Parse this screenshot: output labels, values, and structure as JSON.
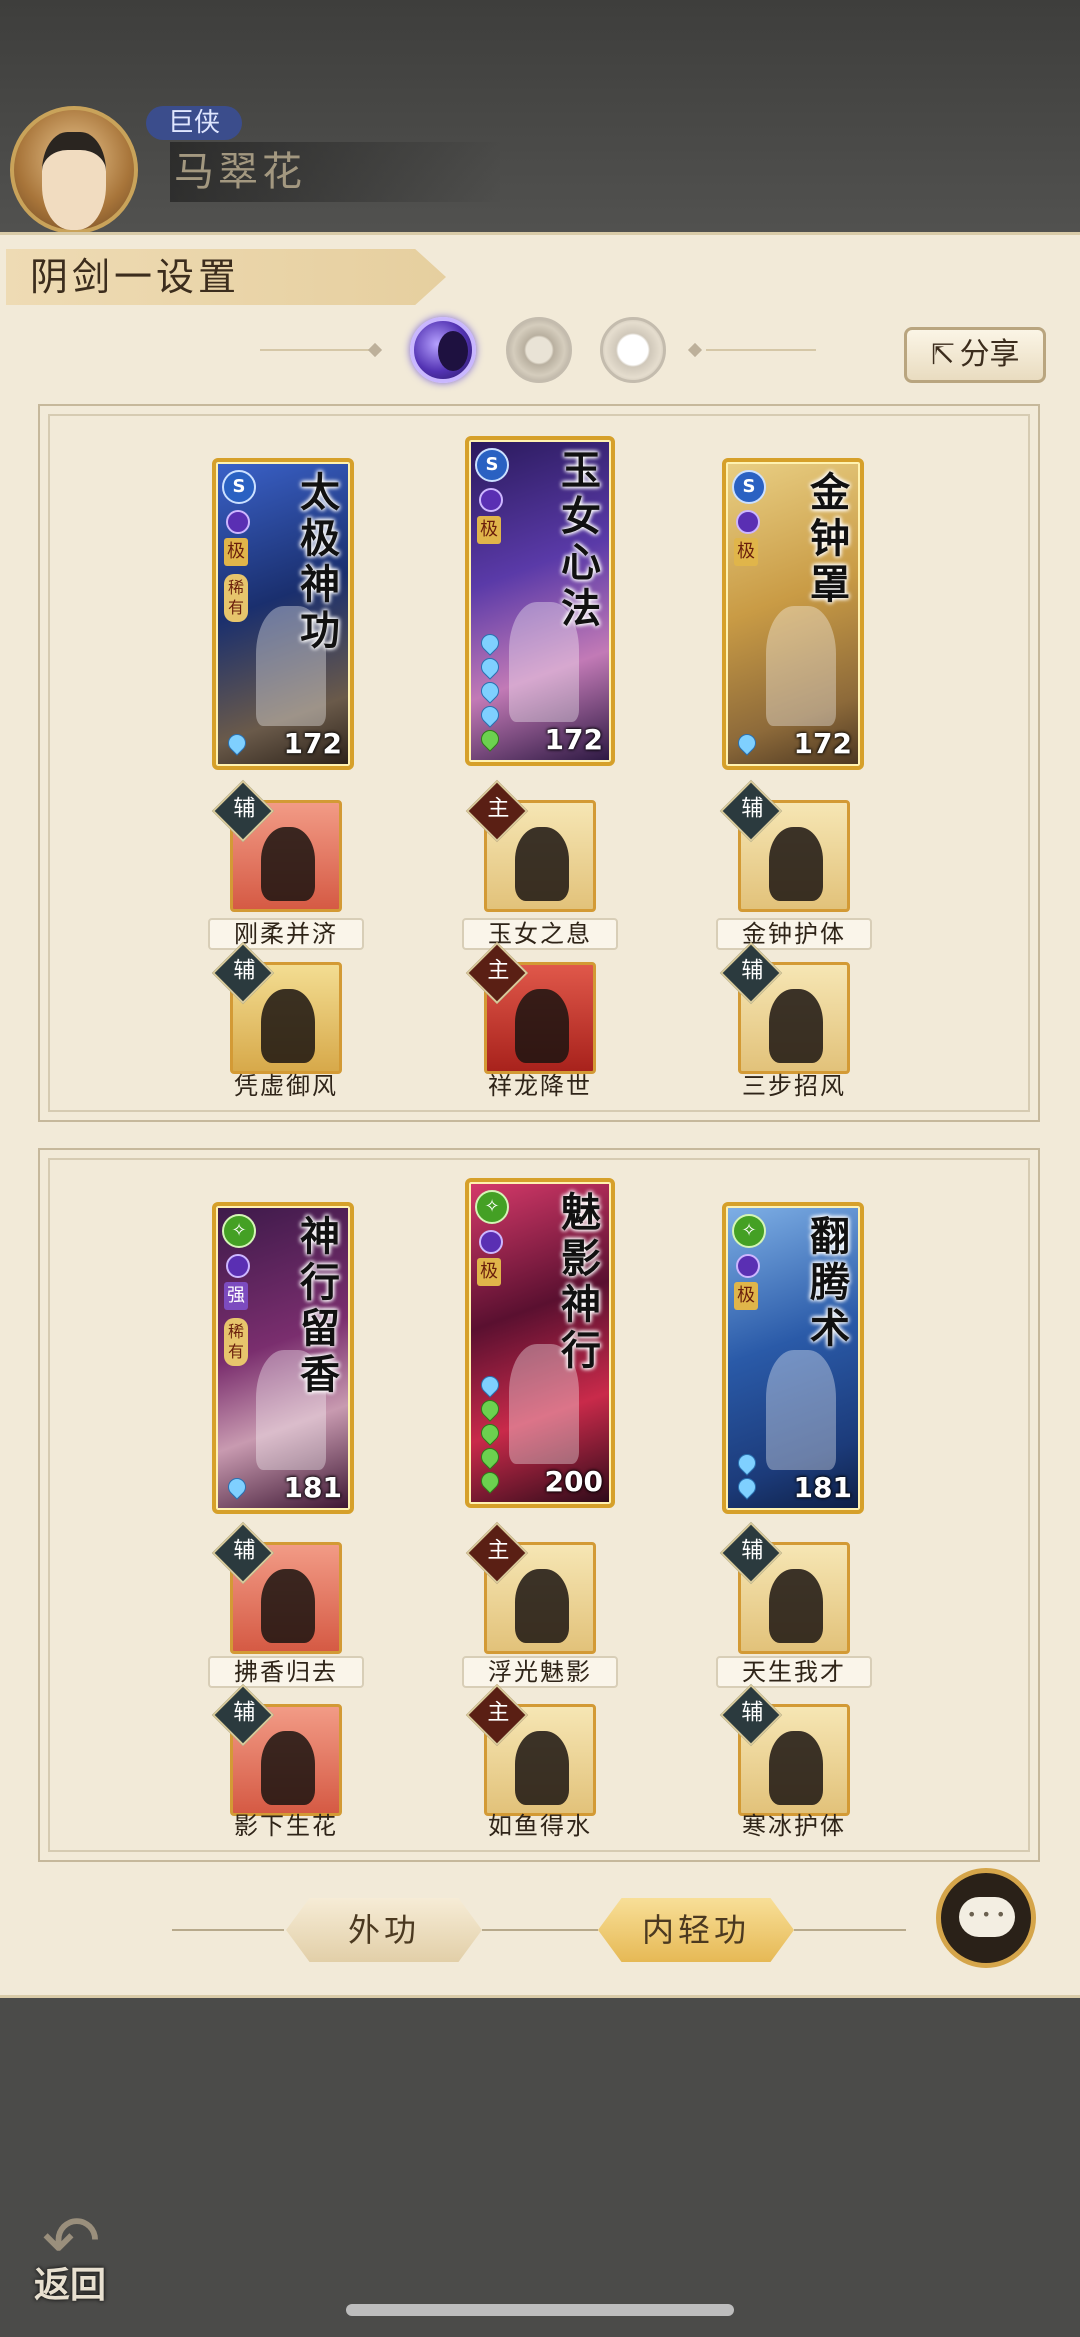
{
  "hero": {
    "title_badge": "巨侠",
    "name": "马翠花"
  },
  "panel": {
    "title": "阴剑一设置",
    "share_label": "分享"
  },
  "sections": [
    {
      "cards": [
        {
          "title": "太极神功",
          "level": "172",
          "type": "S",
          "rank": "极",
          "rare": "稀有"
        },
        {
          "title": "玉女心法",
          "level": "172",
          "type": "S",
          "rank": "极",
          "rare": ""
        },
        {
          "title": "金钟罩",
          "level": "172",
          "type": "S",
          "rank": "极",
          "rare": ""
        }
      ],
      "skills_row1": [
        {
          "badge": "辅",
          "name": "刚柔并济"
        },
        {
          "badge": "主",
          "name": "玉女之息"
        },
        {
          "badge": "辅",
          "name": "金钟护体"
        }
      ],
      "skills_row2": [
        {
          "badge": "辅",
          "name": "凭虚御风"
        },
        {
          "badge": "主",
          "name": "祥龙降世"
        },
        {
          "badge": "辅",
          "name": "三步招风"
        }
      ]
    },
    {
      "cards": [
        {
          "title": "神行留香",
          "level": "181",
          "rank": "强",
          "rare": "稀有"
        },
        {
          "title": "魅影神行",
          "level": "200",
          "rank": "极",
          "rare": ""
        },
        {
          "title": "翻腾术",
          "level": "181",
          "rank": "极",
          "rare": ""
        }
      ],
      "skills_row1": [
        {
          "badge": "辅",
          "name": "拂香归去"
        },
        {
          "badge": "主",
          "name": "浮光魅影"
        },
        {
          "badge": "辅",
          "name": "天生我才"
        }
      ],
      "skills_row2": [
        {
          "badge": "辅",
          "name": "影下生花"
        },
        {
          "badge": "主",
          "name": "如鱼得水"
        },
        {
          "badge": "辅",
          "name": "寒冰护体"
        }
      ]
    }
  ],
  "tabs": {
    "outer": "外功",
    "inner": "内轻功"
  },
  "back_label": "返回",
  "colors": {
    "panel_bg": "#f2ead8",
    "card_border": "#d6a02a",
    "tab_active": "#e6b955"
  }
}
